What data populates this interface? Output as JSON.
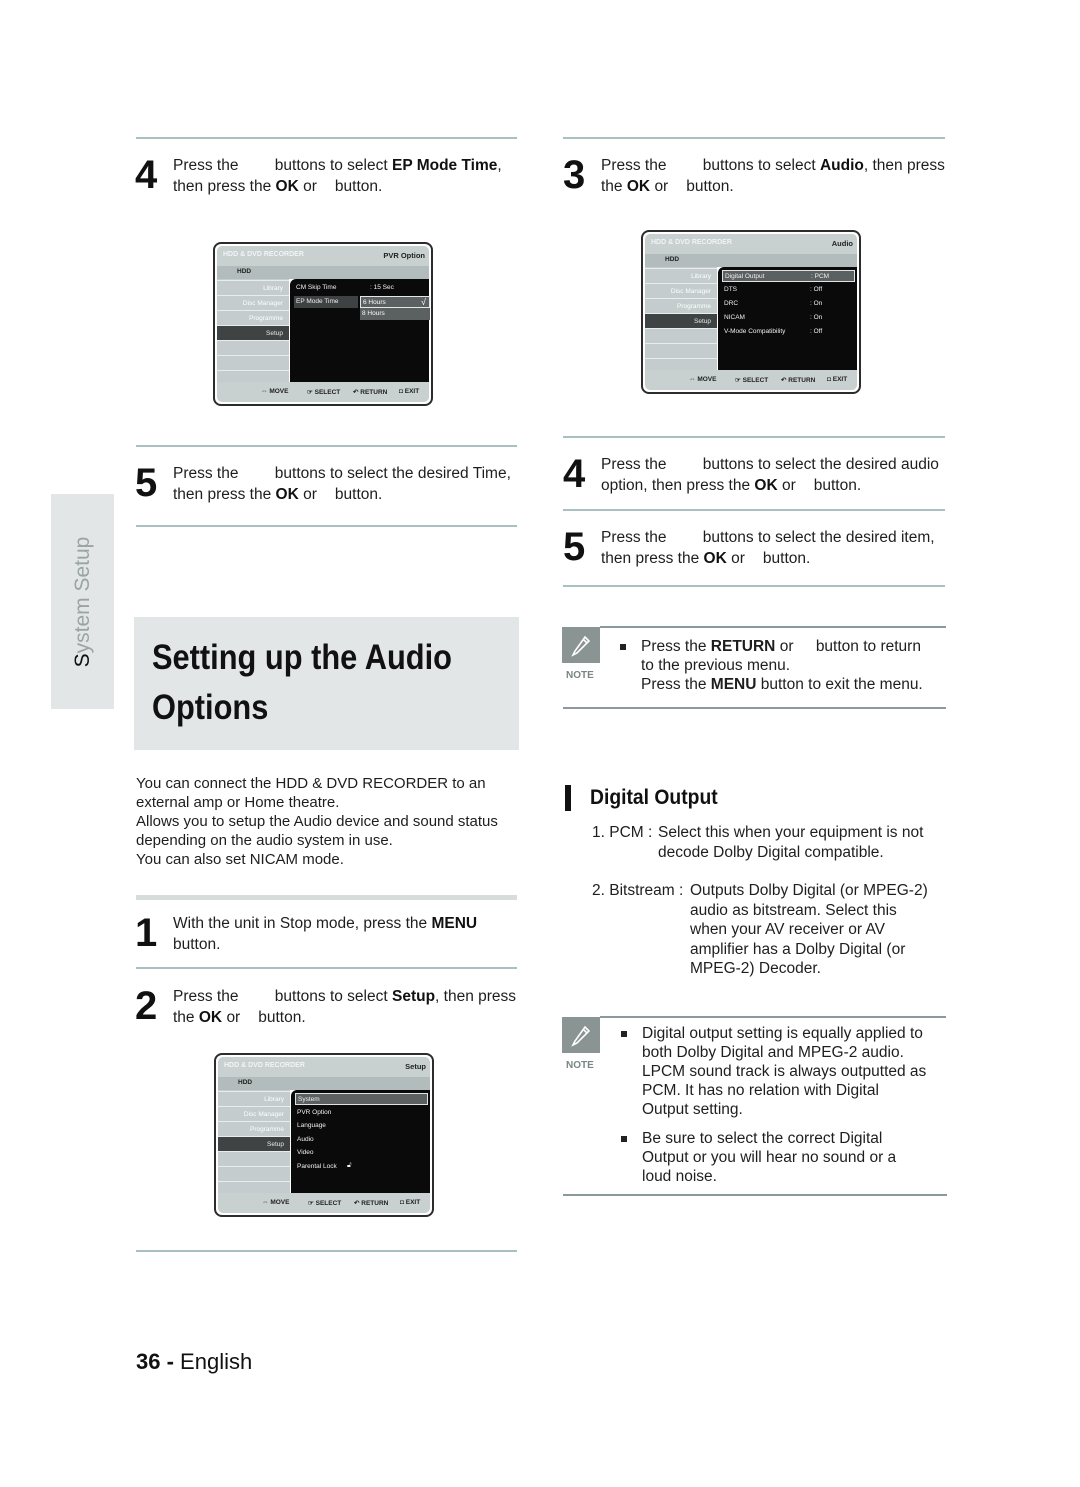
{
  "side_tab": {
    "first_letter": "S",
    "rest": "ystem Setup"
  },
  "title": {
    "line1": "Setting up the Audio",
    "line2": "Options"
  },
  "intro": [
    "You can connect the HDD & DVD RECORDER to an",
    "external amp or Home theatre.",
    "Allows you to setup the Audio device and sound status",
    "depending on the audio system in use.",
    "You can also set NICAM mode."
  ],
  "left_steps": {
    "step4": {
      "num": "4",
      "a": "Press the",
      "b": "buttons to select",
      "bold": "EP Mode Time",
      "c": ",",
      "d": "then press the",
      "ok": "OK",
      "e": "or",
      "f": "button."
    },
    "step5": {
      "num": "5",
      "a": "Press the",
      "b": "buttons to select the desired Time,",
      "d": "then press the",
      "ok": "OK",
      "e": "or",
      "f": "button."
    },
    "step1": {
      "num": "1",
      "a": "With the unit in Stop mode, press the",
      "bold": "MENU",
      "b": "button."
    },
    "step2": {
      "num": "2",
      "a": "Press the",
      "b": "buttons to select",
      "bold": "Setup",
      "c": ", then press",
      "d": "the",
      "ok": "OK",
      "e": "or",
      "f": "button."
    }
  },
  "right_steps": {
    "step3": {
      "num": "3",
      "a": "Press the",
      "b": "buttons to select",
      "bold": "Audio",
      "c": ", then press",
      "d": "the",
      "ok": "OK",
      "e": "or",
      "f": "button."
    },
    "step4": {
      "num": "4",
      "a": "Press the",
      "b": "buttons to select the desired audio",
      "d": "option, then press the",
      "ok": "OK",
      "e": "or",
      "f": "button."
    },
    "step5": {
      "num": "5",
      "a": "Press the",
      "b": "buttons to select the desired item,",
      "d": "then press the",
      "ok": "OK",
      "e": "or",
      "f": "button."
    }
  },
  "osd_common": {
    "brand": "HDD & DVD RECORDER",
    "hdd": "HDD",
    "side_items": [
      "Library",
      "Disc Manager",
      "Programme",
      "Setup"
    ],
    "footer": {
      "move": "MOVE",
      "select": "SELECT",
      "return": "RETURN",
      "exit": "EXIT"
    }
  },
  "osd_pvr": {
    "title": "PVR Option",
    "rows": [
      {
        "key": "CM Skip Time",
        "value": ": 15 Sec"
      },
      {
        "key": "EP Mode Time",
        "value": ""
      }
    ],
    "dropdown": [
      "6 Hours",
      "8 Hours"
    ],
    "selected": "6 Hours"
  },
  "osd_audio": {
    "title": "Audio",
    "rows": [
      {
        "key": "Digital Output",
        "value": ": PCM"
      },
      {
        "key": "DTS",
        "value": ": Off"
      },
      {
        "key": "DRC",
        "value": ": On"
      },
      {
        "key": "NICAM",
        "value": ": On"
      },
      {
        "key": "V-Mode Compatibility",
        "value": ": Off"
      }
    ]
  },
  "osd_setup": {
    "title": "Setup",
    "items": [
      "System",
      "PVR Option",
      "Language",
      "Audio",
      "Video",
      "Parental Lock"
    ]
  },
  "note1": {
    "label": "NOTE",
    "l1a": "Press the",
    "l1b": "RETURN",
    "l1c": "or",
    "l1d": "button to return",
    "l2": "to the previous menu.",
    "l3a": "Press the",
    "l3b": "MENU",
    "l3c": "button to exit the menu."
  },
  "digital_output": {
    "heading": "Digital Output",
    "items": [
      {
        "term": "1. PCM :",
        "lines": [
          "Select this when your equipment is not",
          "decode Dolby Digital compatible."
        ]
      },
      {
        "term": "2. Bitstream :",
        "lines": [
          "Outputs Dolby Digital (or MPEG-2)",
          "audio as bitstream. Select this",
          "when your AV receiver or AV",
          "amplifier has a Dolby Digital (or",
          "MPEG-2) Decoder."
        ]
      }
    ]
  },
  "note2": {
    "label": "NOTE",
    "b1": [
      "Digital output setting is equally applied to",
      "both Dolby Digital and MPEG-2 audio.",
      "LPCM sound track is always outputted as",
      "PCM. It has no relation with Digital",
      "Output setting."
    ],
    "b2": [
      "Be sure to select the correct Digital",
      "Output or you will hear no sound or a",
      "loud noise."
    ]
  },
  "footer": {
    "page": "36",
    "sep": " - ",
    "lang": "English"
  }
}
